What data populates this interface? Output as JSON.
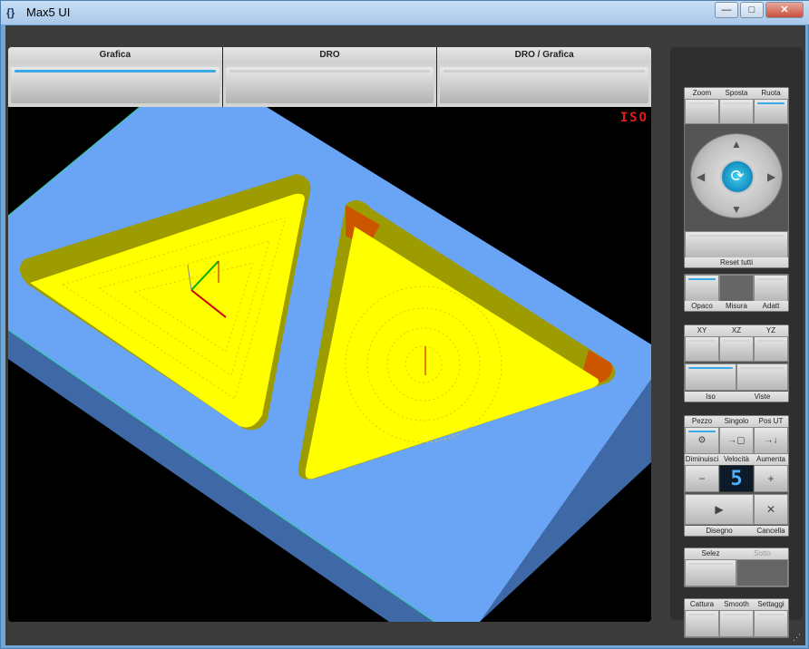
{
  "window": {
    "title": "Max5 UI",
    "icon": "app-icon",
    "minimize": "—",
    "maximize": "□",
    "close": "✕"
  },
  "tabs": [
    {
      "label": "Grafica",
      "active": true
    },
    {
      "label": "DRO",
      "active": false
    },
    {
      "label": "DRO / Grafica",
      "active": false
    }
  ],
  "viewport": {
    "view_label": "ISO",
    "colors": {
      "background": "#000000",
      "stock_top": "#6aa4f4",
      "stock_side": "#3f68a6",
      "pocket_floor": "#ffff00",
      "pocket_wall": "#9c9c00",
      "tool": "#cc5500"
    }
  },
  "controls": {
    "nav": {
      "zoom": "Zoom",
      "pan": "Sposta",
      "rotate": "Ruota",
      "reset": "Reset tutti",
      "active": "rotate"
    },
    "display": {
      "opaque": "Opaco",
      "measure": "Misura",
      "fit": "Adatt"
    },
    "views": {
      "xy": "XY",
      "xz": "XZ",
      "yz": "YZ",
      "iso": "Iso",
      "views": "Viste"
    },
    "follow": {
      "piece": "Pezzo",
      "single": "Singolo",
      "tool_pos": "Pos UT"
    },
    "speed": {
      "decrease": "Diminuisci",
      "speed": "Velocità",
      "increase": "Aumenta",
      "value": "5",
      "minus": "−",
      "plus": "+"
    },
    "draw": {
      "draw": "Disegno",
      "delete": "Cancella",
      "play": "▶",
      "x": "✕"
    },
    "select": {
      "select": "Selez",
      "hatch": "Sotto"
    },
    "capture": {
      "capture": "Cattura",
      "smooth": "Smooth",
      "settings": "Settaggi"
    }
  }
}
